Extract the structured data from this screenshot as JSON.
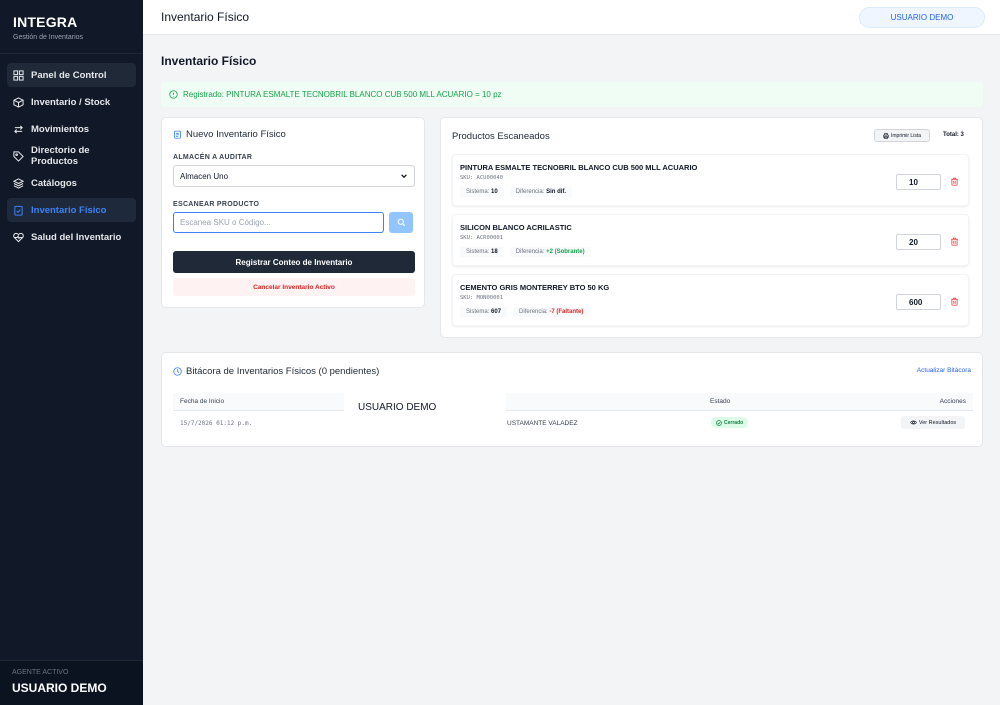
{
  "sidebar": {
    "brand_title": "INTEGRA",
    "brand_subtitle": "Gestión de Inventarios",
    "items": [
      {
        "label": "Panel de Control",
        "icon": "grid-icon"
      },
      {
        "label": "Inventario / Stock",
        "icon": "box-icon"
      },
      {
        "label": "Movimientos",
        "icon": "arrows-icon"
      },
      {
        "label": "Directorio de Productos",
        "icon": "tag-icon"
      },
      {
        "label": "Catálogos",
        "icon": "layers-icon"
      },
      {
        "label": "Inventario Físico",
        "icon": "clipboard-check-icon"
      },
      {
        "label": "Salud del Inventario",
        "icon": "heart-pulse-icon"
      }
    ],
    "agent_label": "Agente activo",
    "agent_name": "USUARIO DEMO"
  },
  "header": {
    "title": "Inventario Físico",
    "user": "USUARIO DEMO"
  },
  "main": {
    "page_title": "Inventario Físico",
    "alert": "Registrado: PINTURA ESMALTE TECNOBRIL BLANCO CUB 500 MLL ACUARIO = 10 pz"
  },
  "new_inventory": {
    "title": "Nuevo Inventario Físico",
    "warehouse_label": "ALMACÉN A AUDITAR",
    "warehouse_value": "Almacen Uno",
    "scan_label": "ESCANEAR PRODUCTO",
    "scan_placeholder": "Escanea SKU o Código...",
    "register_button": "Registrar Conteo de Inventario",
    "cancel_button": "Cancelar Inventario Activo"
  },
  "scanned": {
    "title": "Productos Escaneados",
    "print_button": "Imprimir Lista",
    "total": "Total: 3",
    "system_label": "Sistema:",
    "diff_label": "Diferencia:",
    "products": [
      {
        "name": "PINTURA ESMALTE TECNOBRIL BLANCO CUB 500 MLL ACUARIO",
        "sku": "SKU: ACU00040",
        "system": "10",
        "diff": "Sin dif.",
        "qty": "10"
      },
      {
        "name": "SILICON BLANCO ACRILASTIC",
        "sku": "SKU: ACR00001",
        "system": "18",
        "diff": "+2 (Sobrante)",
        "qty": "20"
      },
      {
        "name": "CEMENTO GRIS MONTERREY BTO 50 KG",
        "sku": "SKU: MON00001",
        "system": "607",
        "diff": "-7 (Faltante)",
        "qty": "600"
      }
    ]
  },
  "log": {
    "title": "Bitácora de Inventarios Físicos (0 pendientes)",
    "refresh": "Actualizar Bitácora",
    "columns": {
      "date": "Fecha de Inicio",
      "status": "Estado",
      "actions": "Acciones"
    },
    "rows": [
      {
        "date": "15/7/2026 01:12 p.m.",
        "user": "USTAMANTE VALADEZ",
        "status": "Cerrado",
        "action": "Ver Resultados"
      }
    ],
    "overlay_user": "USUARIO DEMO"
  },
  "colors": {
    "sidebar_bg": "#111827",
    "accent": "#3b82f6",
    "success": "#16a34a",
    "danger": "#dc2626"
  }
}
